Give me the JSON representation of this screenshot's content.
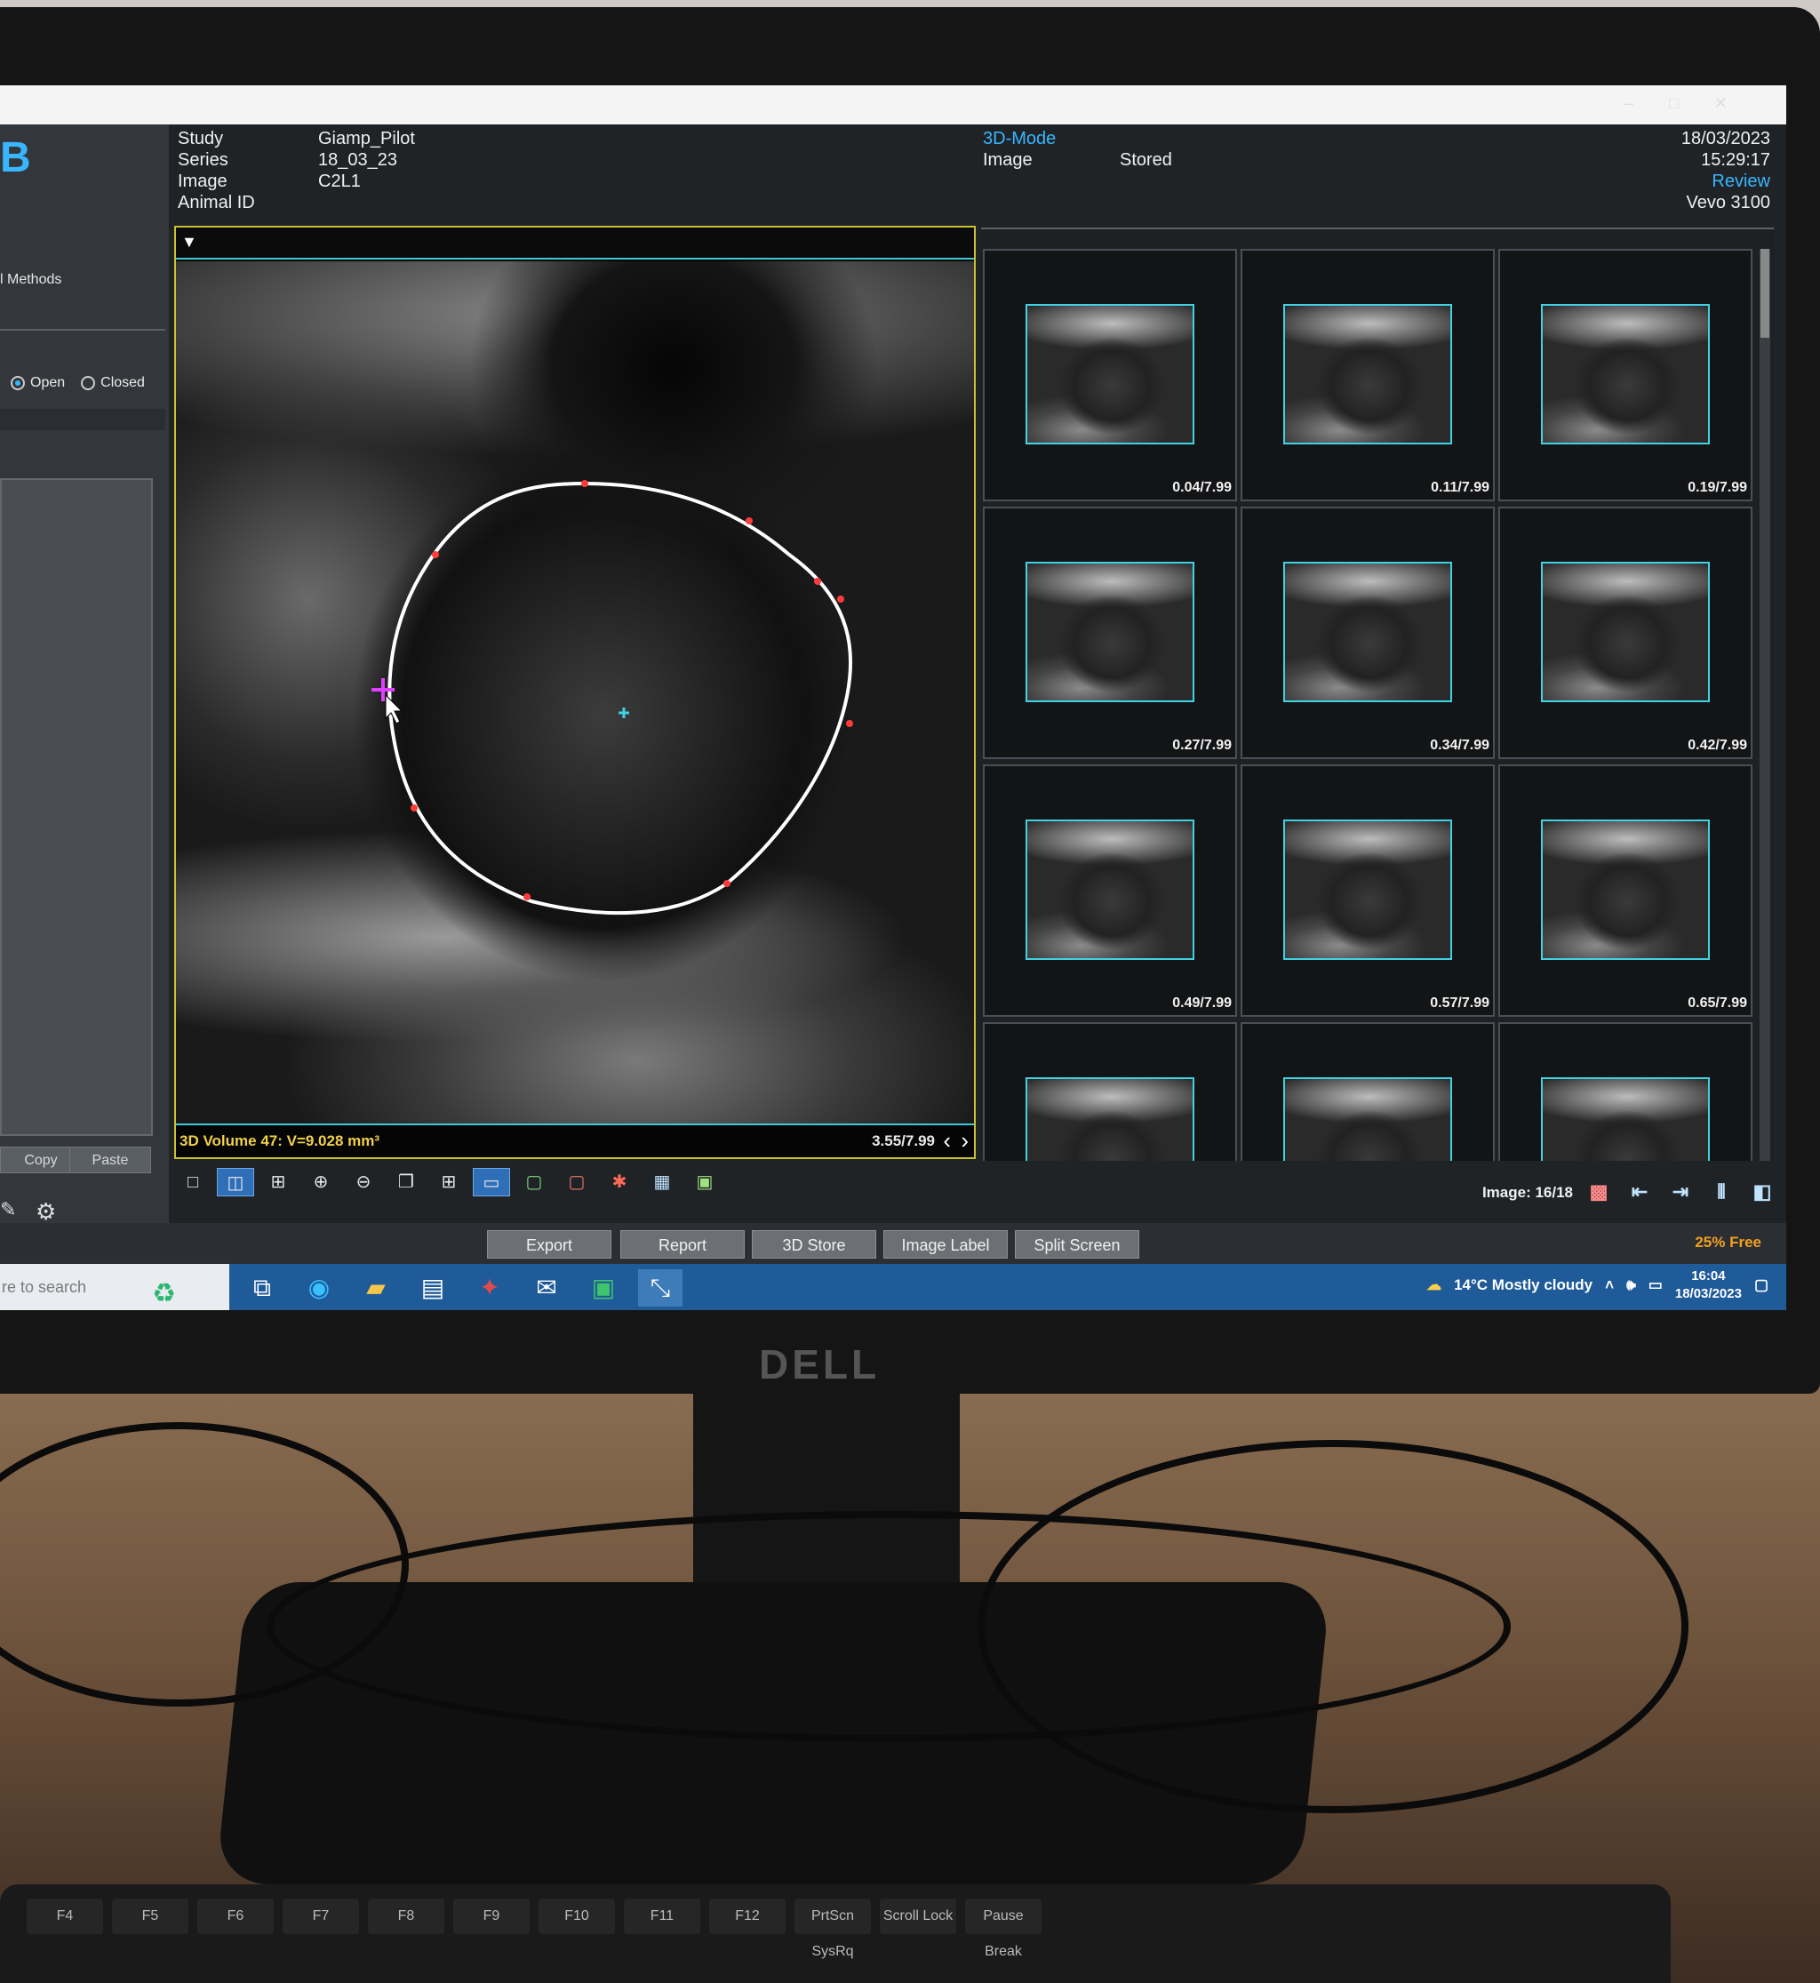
{
  "header": {
    "study_label": "Study",
    "series_label": "Series",
    "image_label": "Image",
    "animal_label": "Animal ID",
    "study_value": "Giamp_Pilot",
    "series_value": "18_03_23",
    "image_value": "C2L1",
    "mode": "3D-Mode",
    "image_word": "Image",
    "stored": "Stored",
    "date": "18/03/2023",
    "time": "15:29:17",
    "review": "Review",
    "device": "Vevo 3100"
  },
  "left_panel": {
    "logo": "B",
    "methods": "l Methods",
    "radio_open": "Open",
    "radio_closed": "Closed",
    "copy": "Copy",
    "paste": "Paste"
  },
  "viewport": {
    "volume_label": "3D Volume 47: V=9.028 mm³",
    "frame_label": "3.55/7.99"
  },
  "thumbnails": [
    {
      "label": "0.04/7.99"
    },
    {
      "label": "0.11/7.99"
    },
    {
      "label": "0.19/7.99"
    },
    {
      "label": "0.27/7.99"
    },
    {
      "label": "0.34/7.99"
    },
    {
      "label": "0.42/7.99"
    },
    {
      "label": "0.49/7.99"
    },
    {
      "label": "0.57/7.99"
    },
    {
      "label": "0.65/7.99"
    },
    {
      "label": ""
    },
    {
      "label": ""
    },
    {
      "label": ""
    }
  ],
  "status": {
    "image_count": "Image: 16/18"
  },
  "bottom_buttons": {
    "export": "Export",
    "report": "Report",
    "store3d": "3D Store",
    "image_label": "Image Label",
    "split_screen": "Split Screen",
    "free": "25% Free"
  },
  "taskbar": {
    "search_placeholder": "re to search",
    "weather": "14°C  Mostly cloudy",
    "clock_time": "16:04",
    "clock_date": "18/03/2023"
  },
  "monitor": {
    "brand": "DELL"
  },
  "keyboard": {
    "keys": [
      "F4",
      "F5",
      "F6",
      "F7",
      "F8",
      "F9",
      "F10",
      "F11",
      "F12",
      "PrtScn SysRq",
      "Scroll Lock",
      "Pause Break"
    ]
  },
  "colors": {
    "accent_blue": "#38b6ff",
    "contour": "#ffffff",
    "contour_points": "#ff3b3b",
    "volume_text": "#f1d04b",
    "free_space": "#f3a01f"
  }
}
